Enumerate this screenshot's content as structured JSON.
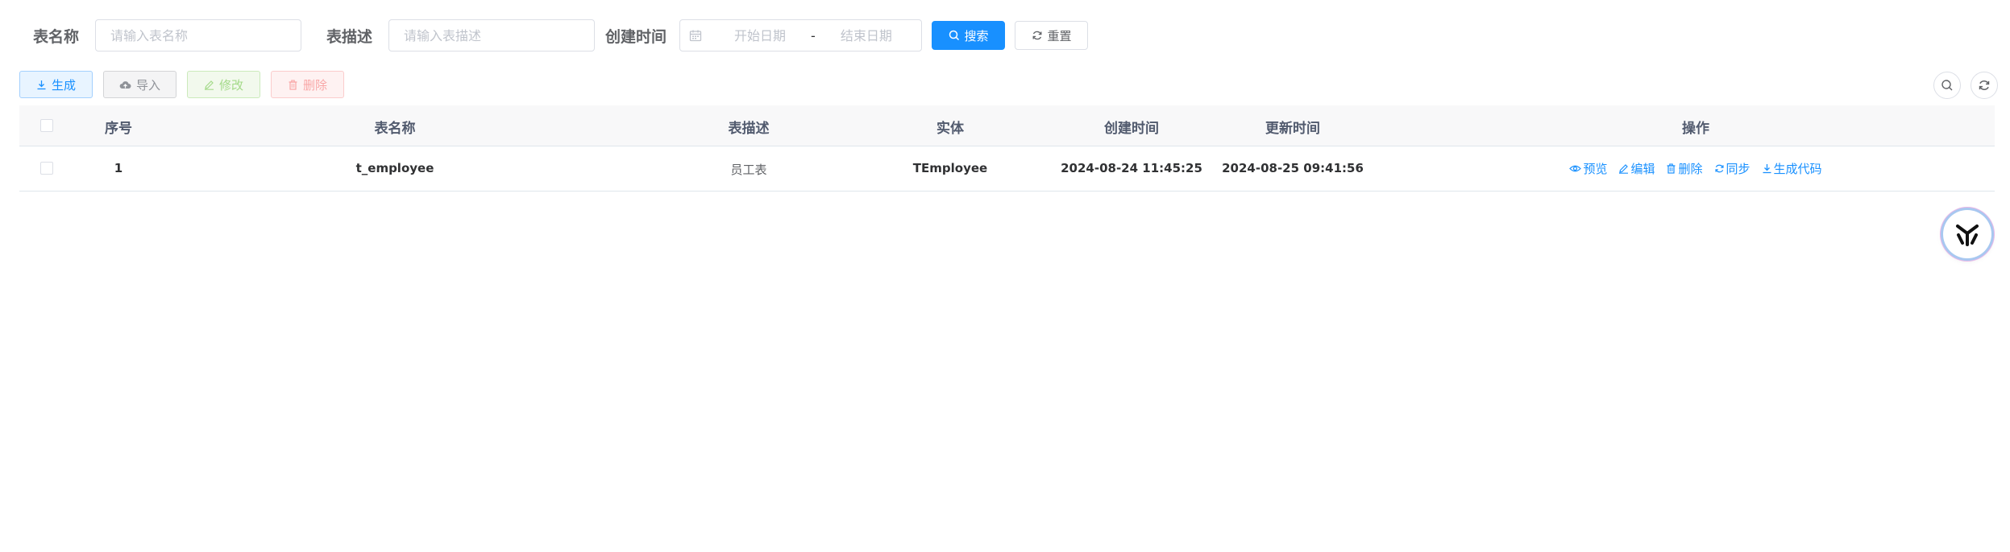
{
  "search": {
    "table_name_label": "表名称",
    "table_name_placeholder": "请输入表名称",
    "table_desc_label": "表描述",
    "table_desc_placeholder": "请输入表描述",
    "create_time_label": "创建时间",
    "start_date_placeholder": "开始日期",
    "range_separator": "-",
    "end_date_placeholder": "结束日期",
    "search_button": "搜索",
    "reset_button": "重置"
  },
  "toolbar": {
    "generate": "生成",
    "import": "导入",
    "modify": "修改",
    "delete": "删除"
  },
  "table": {
    "headers": {
      "index": "序号",
      "table_name": "表名称",
      "table_desc": "表描述",
      "entity": "实体",
      "create_time": "创建时间",
      "update_time": "更新时间",
      "actions": "操作"
    },
    "rows": [
      {
        "index": "1",
        "table_name": "t_employee",
        "table_desc": "员工表",
        "entity": "TEmployee",
        "create_time": "2024-08-24 11:45:25",
        "update_time": "2024-08-25 09:41:56"
      }
    ],
    "row_actions": {
      "preview": "预览",
      "edit": "编辑",
      "delete": "删除",
      "sync": "同步",
      "gen_code": "生成代码"
    }
  },
  "colors": {
    "primary": "#1890ff",
    "header_bg": "#f8f8f9",
    "border": "#dcdfe6"
  },
  "icons": [
    "calendar-icon",
    "search-icon",
    "refresh-icon",
    "download-icon",
    "cloud-upload-icon",
    "edit-icon",
    "delete-icon",
    "eye-icon"
  ]
}
